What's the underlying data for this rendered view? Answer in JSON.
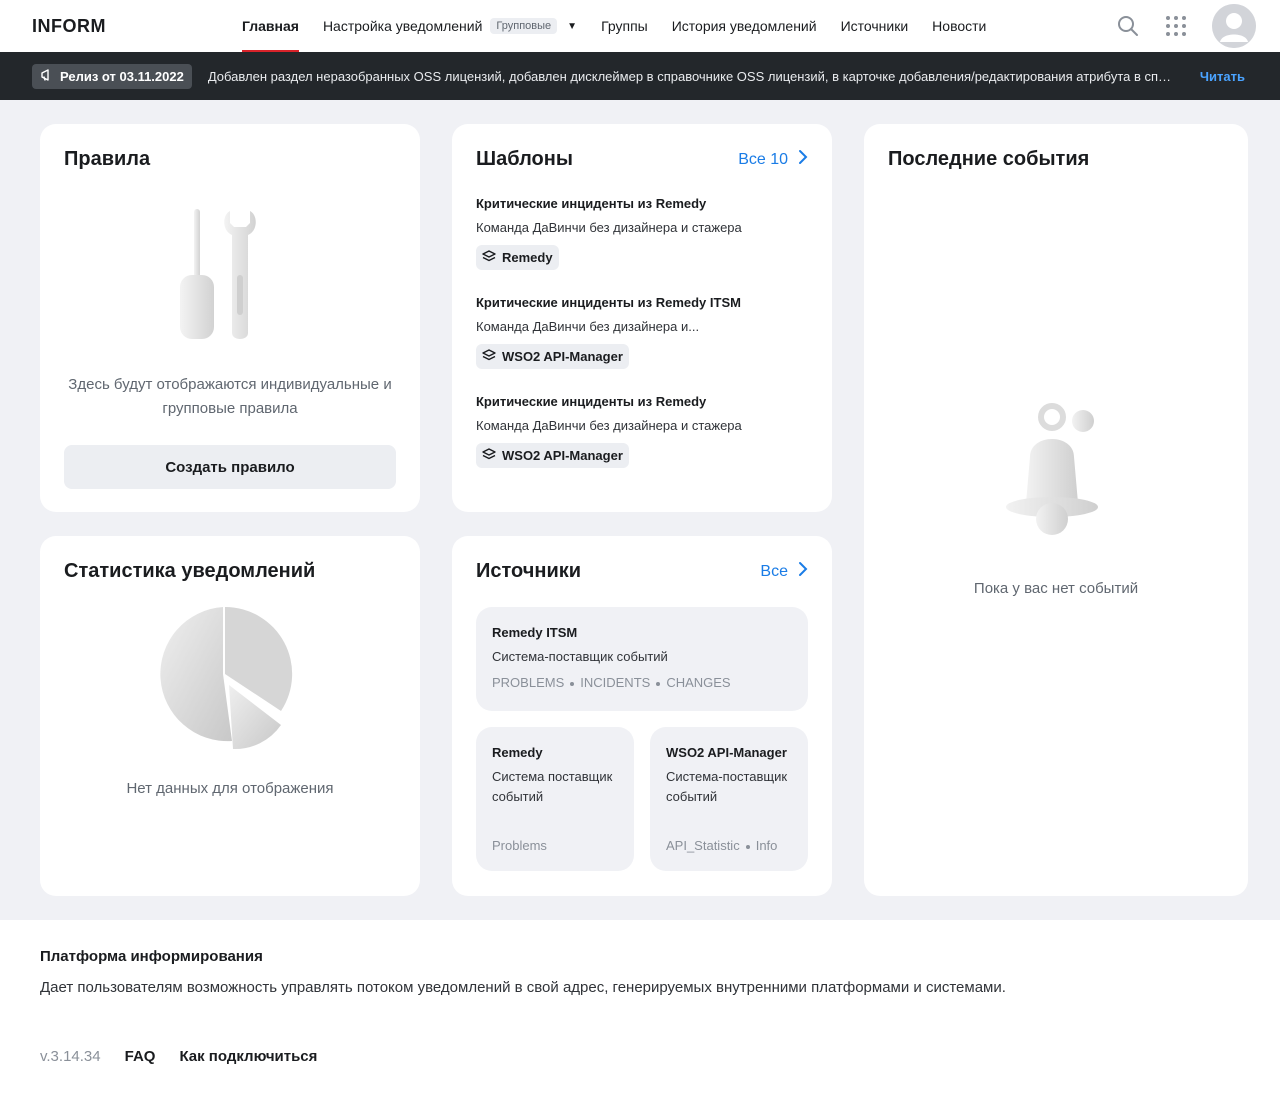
{
  "header": {
    "logo": "INFORM",
    "nav": [
      {
        "label": "Главная",
        "active": true
      },
      {
        "label": "Настройка уведомлений",
        "badge": "Групповые"
      },
      {
        "label": "Группы"
      },
      {
        "label": "История уведомлений"
      },
      {
        "label": "Источники"
      },
      {
        "label": "Новости"
      }
    ]
  },
  "release": {
    "badge": "Релиз от 03.11.2022",
    "text": "Добавлен раздел неразобранных OSS лицензий, добавлен дисклеймер в справочнике OSS лицензий, в карточке добавления/редактирования атрибута в справочнике OSS лицензий",
    "link": "Читать"
  },
  "rules": {
    "title": "Правила",
    "empty_text": "Здесь будут отображаются индивидуальные и групповые правила",
    "button": "Создать правило"
  },
  "templates": {
    "title": "Шаблоны",
    "all_link": "Все 10",
    "items": [
      {
        "title": "Критические инциденты из Remedy",
        "team": "Команда ДаВинчи без дизайнера и стажера",
        "source": "Remedy"
      },
      {
        "title": "Критические инциденты из Remedy ITSM",
        "team": "Команда ДаВинчи без дизайнера и...",
        "source": "WSO2 API-Manager"
      },
      {
        "title": "Критические инциденты из Remedy",
        "team": "Команда ДаВинчи без дизайнера и стажера",
        "source": "WSO2 API-Manager"
      }
    ]
  },
  "events": {
    "title": "Последние события",
    "empty_text": "Пока у вас нет событий"
  },
  "stats": {
    "title": "Статистика уведомлений",
    "empty_text": "Нет данных для отображения"
  },
  "sources": {
    "title": "Источники",
    "all_link": "Все",
    "big": {
      "name": "Remedy ITSM",
      "desc": "Система-поставщик событий",
      "tags": [
        "PROBLEMS",
        "INCIDENTS",
        "CHANGES"
      ]
    },
    "small": [
      {
        "name": "Remedy",
        "desc": "Система поставщик событий",
        "tags": [
          "Problems"
        ]
      },
      {
        "name": "WSO2 API-Manager",
        "desc": "Система-поставщик событий",
        "tags": [
          "API_Statistic",
          "Info"
        ]
      }
    ]
  },
  "footer": {
    "title": "Платформа информирования",
    "desc": "Дает пользователям возможность управлять потоком уведомлений в свой адрес, генерируемых внутренними платформами и системами.",
    "version": "v.3.14.34",
    "links": [
      "FAQ",
      "Как подключиться"
    ]
  }
}
